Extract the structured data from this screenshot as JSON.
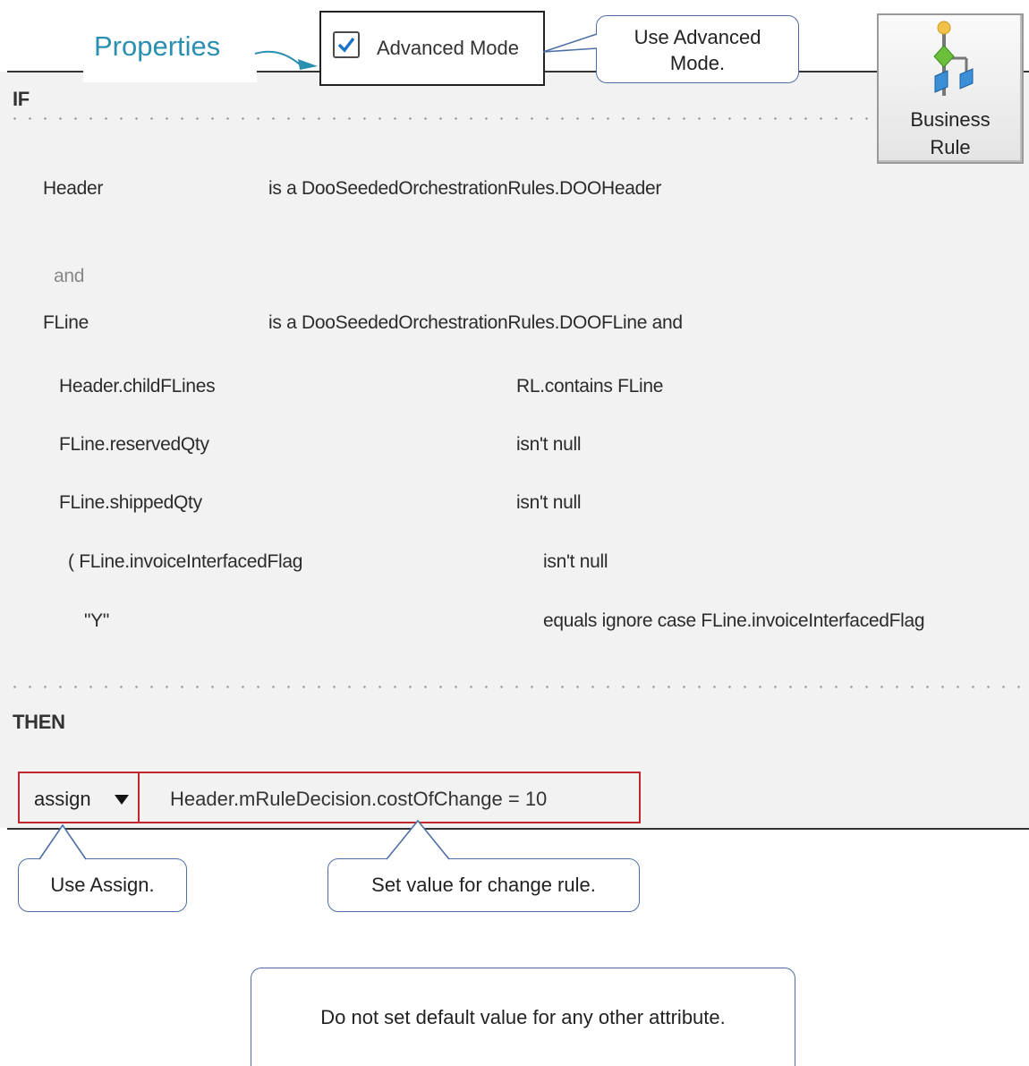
{
  "properties_label": "Properties",
  "advanced_mode": {
    "label": "Advanced Mode",
    "checked": true
  },
  "callouts": {
    "advanced_line1": "Use Advanced",
    "advanced_line2": "Mode.",
    "assign": "Use Assign.",
    "set_value": "Set value  for change rule.",
    "default_note": "Do not set default value  for any other attribute."
  },
  "business_rule": {
    "line1": "Business",
    "line2": "Rule"
  },
  "rule": {
    "if_label": "IF",
    "then_label": "THEN",
    "header_var": "Header",
    "header_type": "is a  DooSeededOrchestrationRules.DOOHeader",
    "and_label": "and",
    "fline_var": "FLine",
    "fline_type": "is a  DooSeededOrchestrationRules.DOOFLine   and",
    "conditions": [
      {
        "left": "Header.childFLines",
        "right": "RL.contains  FLine"
      },
      {
        "left": "FLine.reservedQty",
        "right": "isn't null"
      },
      {
        "left": "FLine.shippedQty",
        "right": "isn't null"
      },
      {
        "left": "(  FLine.invoiceInterfacedFlag",
        "right": "isn't null"
      },
      {
        "left": "\"Y\"",
        "right": "equals ignore case  FLine.invoiceInterfacedFlag"
      }
    ],
    "action": {
      "type": "assign",
      "expression": "Header.mRuleDecision.costOfChange   = 10"
    }
  },
  "colors": {
    "accent_blue": "#2a8fb0",
    "highlight_red": "#c0282e",
    "callout_border": "#4d6fa5",
    "checkbox_check": "#1a73c9"
  }
}
